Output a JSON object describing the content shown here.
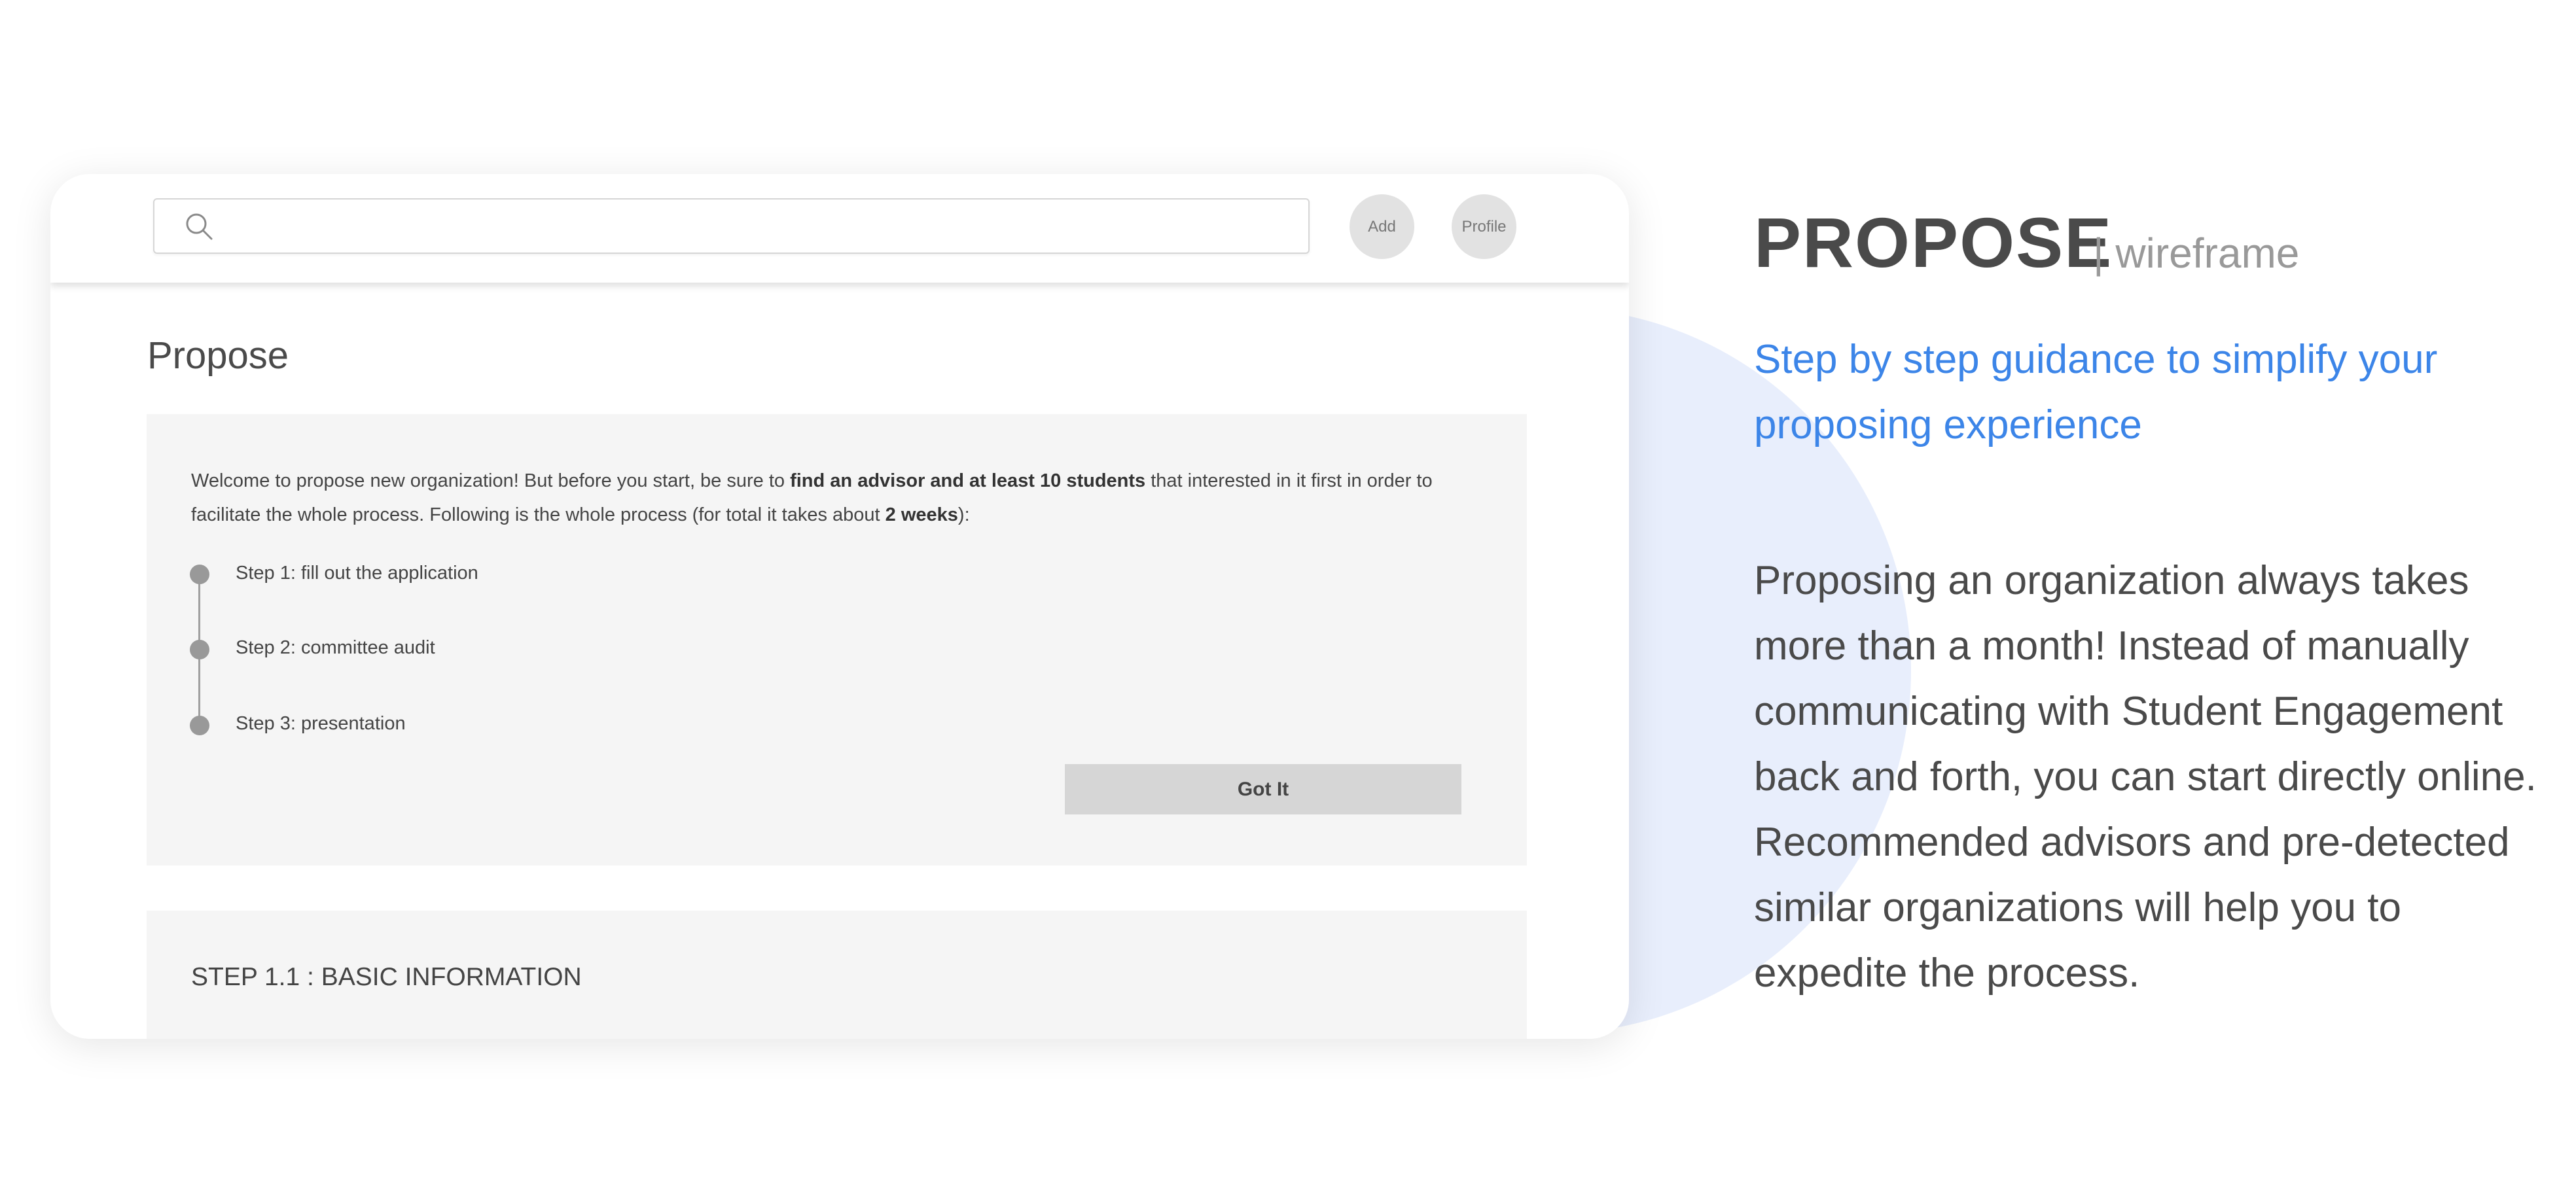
{
  "toolbar": {
    "add_label": "Add",
    "profile_label": "Profile",
    "search_placeholder": ""
  },
  "main": {
    "title": "Propose",
    "intro": {
      "part1": "Welcome to propose new organization! But before you start, be sure to ",
      "bold1": "find an advisor and at least 10 students",
      "part2": " that interested in it first in order to facilitate the whole process. Following is the whole process (for total it takes about ",
      "bold2": "2 weeks",
      "part3": "):"
    },
    "steps": [
      {
        "label": "Step 1: fill out the application"
      },
      {
        "label": "Step 2: committee audit"
      },
      {
        "label": "Step 3: presentation"
      }
    ],
    "got_it_label": "Got It",
    "section_heading": "STEP 1.1 : BASIC INFORMATION"
  },
  "side": {
    "title": "PROPOSE",
    "subtitle": "| wireframe",
    "tagline": "Step by step guidance to simplify your proposing experience",
    "description": "Proposing an organization always takes more than a month! Instead of manually communicating with Student Engagement back and forth, you can start directly online. Recommended advisors and pre-detected similar organizations will help you to expedite the process."
  },
  "colors": {
    "accent": "#3c85e8",
    "blob": "#e8eefc",
    "panel": "#f5f5f5"
  },
  "icons": {
    "search": "search-icon"
  }
}
